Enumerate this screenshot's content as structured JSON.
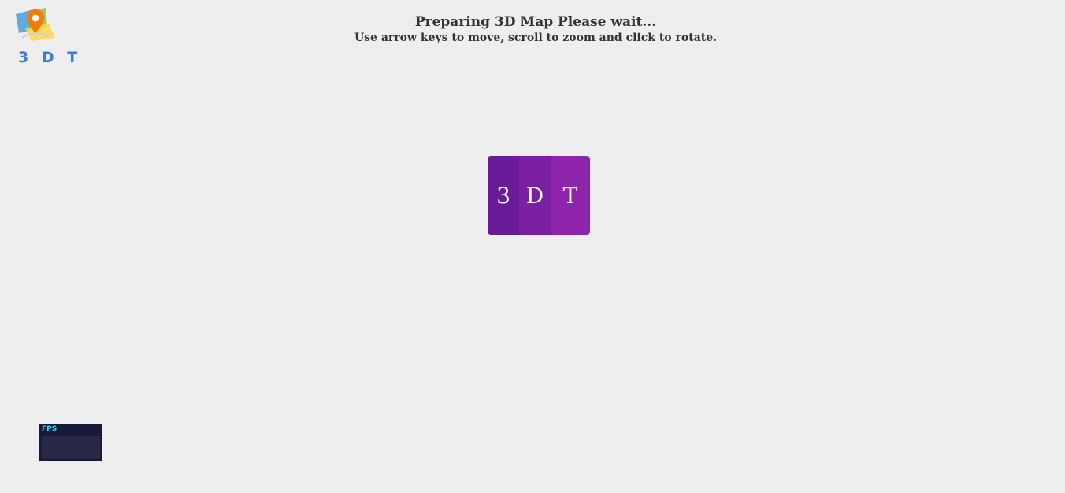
{
  "logo": {
    "text": "3 D T",
    "icon": "map-pin-icon",
    "colors": {
      "text": "#3b7ddd",
      "pin": "#f57c00",
      "map_blue": "#4fa3e0",
      "map_green": "#8bc34a",
      "map_yellow": "#ffd54f"
    }
  },
  "header": {
    "title": "Preparing 3D Map Please wait...",
    "subtitle": "Use arrow keys to move, scroll to zoom and click to rotate."
  },
  "loader": {
    "letters": [
      "3",
      "D",
      "T"
    ],
    "colors": [
      "#6a1b9a",
      "#7b1fa2",
      "#8e24aa"
    ]
  },
  "stats": {
    "label": "FPS",
    "colors": {
      "background": "#191a3a",
      "graph": "#262845",
      "text": "#22ddee"
    }
  }
}
